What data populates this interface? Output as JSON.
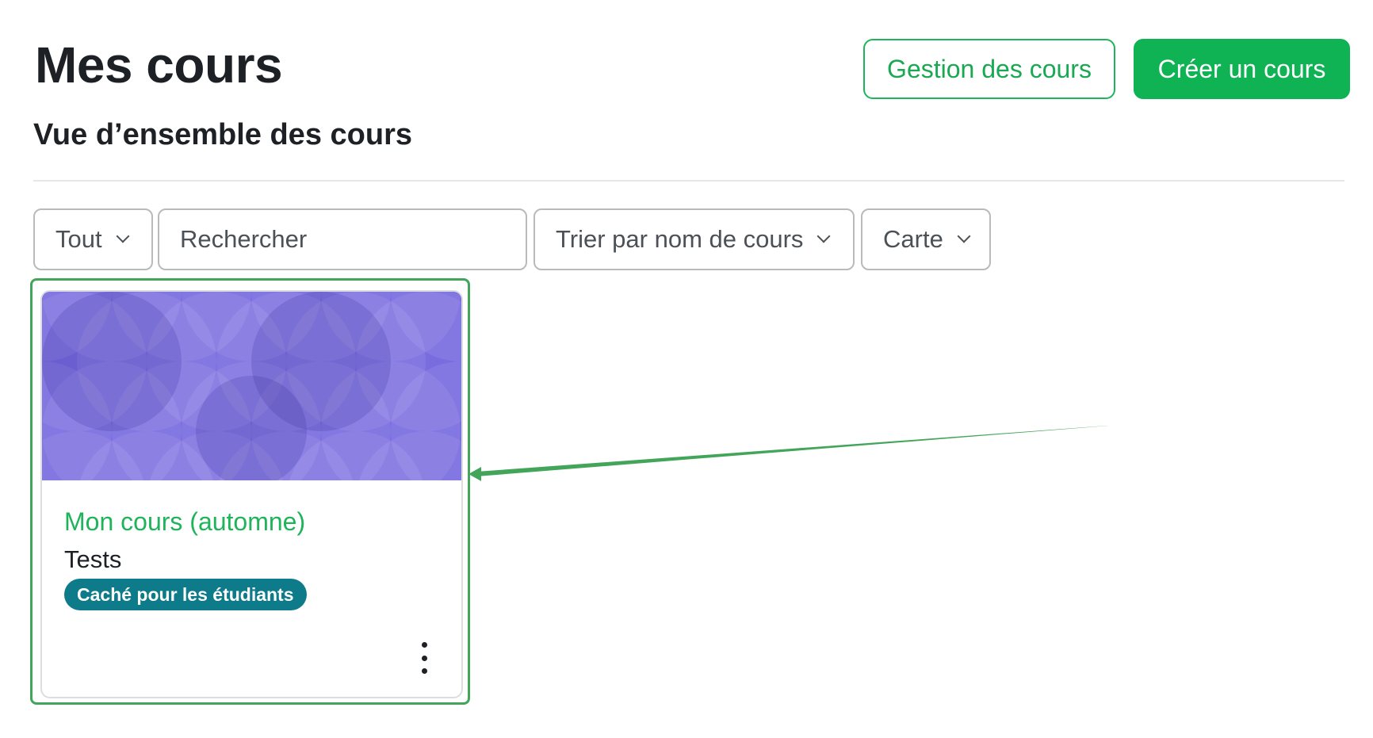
{
  "header": {
    "title": "Mes cours",
    "manage_button": "Gestion des cours",
    "create_button": "Créer un cours"
  },
  "overview": {
    "title": "Vue d’ensemble des cours",
    "filters": {
      "grouping": "Tout",
      "search_placeholder": "Rechercher",
      "sort": "Trier par nom de cours",
      "display": "Carte"
    }
  },
  "courses": [
    {
      "name": "Mon cours (automne)",
      "category": "Tests",
      "badge": "Caché pour les étudiants"
    }
  ],
  "colors": {
    "accent": "#0fb354",
    "link": "#1fb35a",
    "badge": "#0d7b8a",
    "card_image": "#6e60dd",
    "highlight": "#43a55a"
  },
  "icons": {
    "filter_chevron": "chevron-down-icon",
    "course_menu": "kebab-menu-icon"
  }
}
